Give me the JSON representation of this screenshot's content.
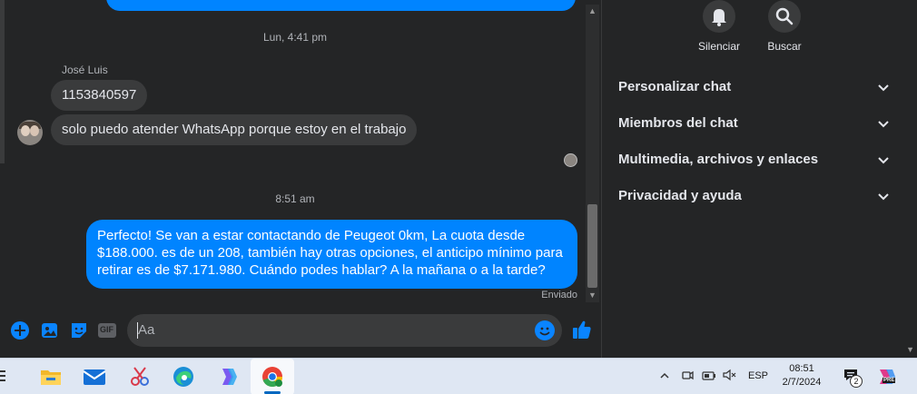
{
  "chat": {
    "timestamp_1": "Lun, 4:41 pm",
    "sender_name": "José Luis",
    "incoming_messages": [
      "1153840597",
      "solo puedo atender WhatsApp porque estoy en el trabajo"
    ],
    "timestamp_2": "8:51 am",
    "outgoing_message": "Perfecto!  Se van a estar contactando de Peugeot 0km, La cuota desde $188.000. es de un 208, también hay otras opciones, el anticipo mínimo para retirar es de $7.171.980. Cuándo podes hablar? A la mañana o a la tarde?",
    "status": "Enviado"
  },
  "composer": {
    "placeholder": "Aa",
    "icons": [
      "plus-circle-icon",
      "image-icon",
      "sticker-icon",
      "gif-icon",
      "emoji-icon",
      "like-icon"
    ],
    "gif_label": "GIF"
  },
  "panel": {
    "actions": [
      {
        "label": "Silenciar",
        "icon": "bell-icon"
      },
      {
        "label": "Buscar",
        "icon": "search-icon"
      }
    ],
    "sections": [
      "Personalizar chat",
      "Miembros del chat",
      "Multimedia, archivos y enlaces",
      "Privacidad y ayuda"
    ]
  },
  "taskbar": {
    "apps": [
      "file-explorer-icon",
      "mail-icon",
      "snipping-tool-icon",
      "edge-icon",
      "copilot-icon",
      "chrome-icon"
    ],
    "language": "ESP",
    "time": "08:51",
    "date": "2/7/2024",
    "notification_count": "2",
    "pre_badge": "PRE"
  },
  "colors": {
    "accent": "#0084ff",
    "background": "#242526",
    "bubble_incoming": "#3a3b3c",
    "taskbar": "#dfe7f3"
  }
}
